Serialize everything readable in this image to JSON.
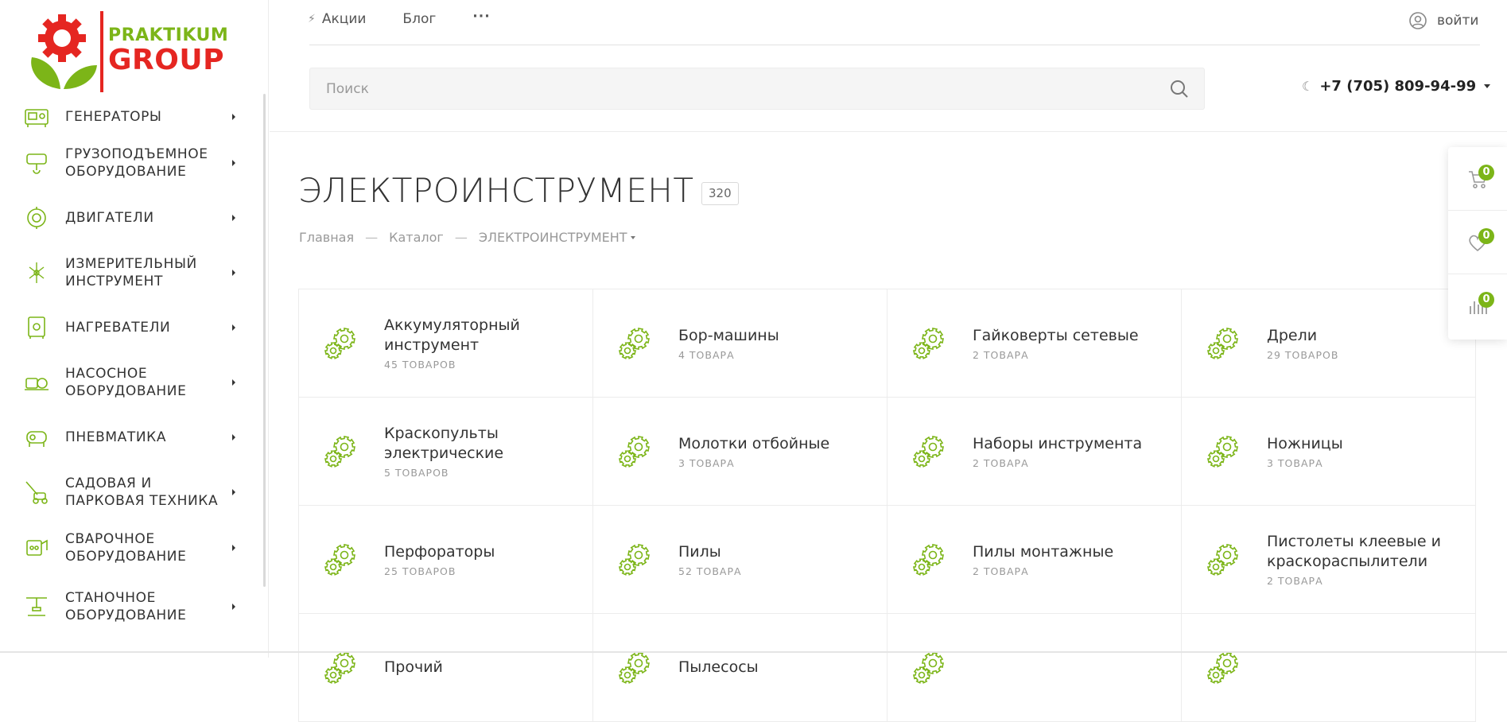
{
  "brand": {
    "logo_line1": "PRAKTIKUM",
    "logo_line2": "GROUP",
    "colors": {
      "accent": "#7cb518",
      "brand_red": "#e52621",
      "text": "#333333",
      "muted": "#999999"
    }
  },
  "topnav": {
    "items": [
      {
        "label": "Акции",
        "icon": "bolt-icon"
      },
      {
        "label": "Блог"
      },
      {
        "label": "···"
      }
    ],
    "login_label": "войти"
  },
  "search": {
    "placeholder": "Поиск"
  },
  "phone": "+7 (705) 809-94-99",
  "sidebar": {
    "items": [
      {
        "label": "Генераторы",
        "icon": "generator-icon"
      },
      {
        "label": "Грузоподъемное оборудование",
        "icon": "hoist-icon"
      },
      {
        "label": "Двигатели",
        "icon": "engine-icon"
      },
      {
        "label": "Измерительный инструмент",
        "icon": "laser-level-icon"
      },
      {
        "label": "Нагреватели",
        "icon": "heater-icon"
      },
      {
        "label": "Насосное оборудование",
        "icon": "pump-icon"
      },
      {
        "label": "Пневматика",
        "icon": "compressor-icon"
      },
      {
        "label": "Садовая и парковая техника",
        "icon": "lawn-mower-icon"
      },
      {
        "label": "Сварочное оборудование",
        "icon": "welder-icon"
      },
      {
        "label": "Станочное оборудование",
        "icon": "machine-tool-icon"
      }
    ]
  },
  "page": {
    "title": "ЭЛЕКТРОИНСТРУМЕНТ",
    "count": "320"
  },
  "breadcrumb": {
    "home": "Главная",
    "catalog": "Каталог",
    "current": "ЭЛЕКТРОИНСТРУМЕНТ",
    "separator": "—"
  },
  "categories": [
    {
      "title": "Аккумуляторный инструмент",
      "count": "45 товаров"
    },
    {
      "title": "Бор-машины",
      "count": "4 товара"
    },
    {
      "title": "Гайковерты сетевые",
      "count": "2 товара"
    },
    {
      "title": "Дрели",
      "count": "29 товаров"
    },
    {
      "title": "Краскопульты электрические",
      "count": "5 товаров"
    },
    {
      "title": "Молотки отбойные",
      "count": "3 товара"
    },
    {
      "title": "Наборы инструмента",
      "count": "2 товара"
    },
    {
      "title": "Ножницы",
      "count": "3 товара"
    },
    {
      "title": "Перфораторы",
      "count": "25 товаров"
    },
    {
      "title": "Пилы",
      "count": "52 товара"
    },
    {
      "title": "Пилы монтажные",
      "count": "2 товара"
    },
    {
      "title": "Пистолеты клеевые и краскораспылители",
      "count": "2 товара"
    },
    {
      "title": "Прочий",
      "count": ""
    },
    {
      "title": "Пылесосы",
      "count": ""
    },
    {
      "title": "",
      "count": ""
    },
    {
      "title": "",
      "count": ""
    }
  ],
  "float_panel": {
    "cart_count": "0",
    "wishlist_count": "0",
    "compare_count": "0"
  }
}
